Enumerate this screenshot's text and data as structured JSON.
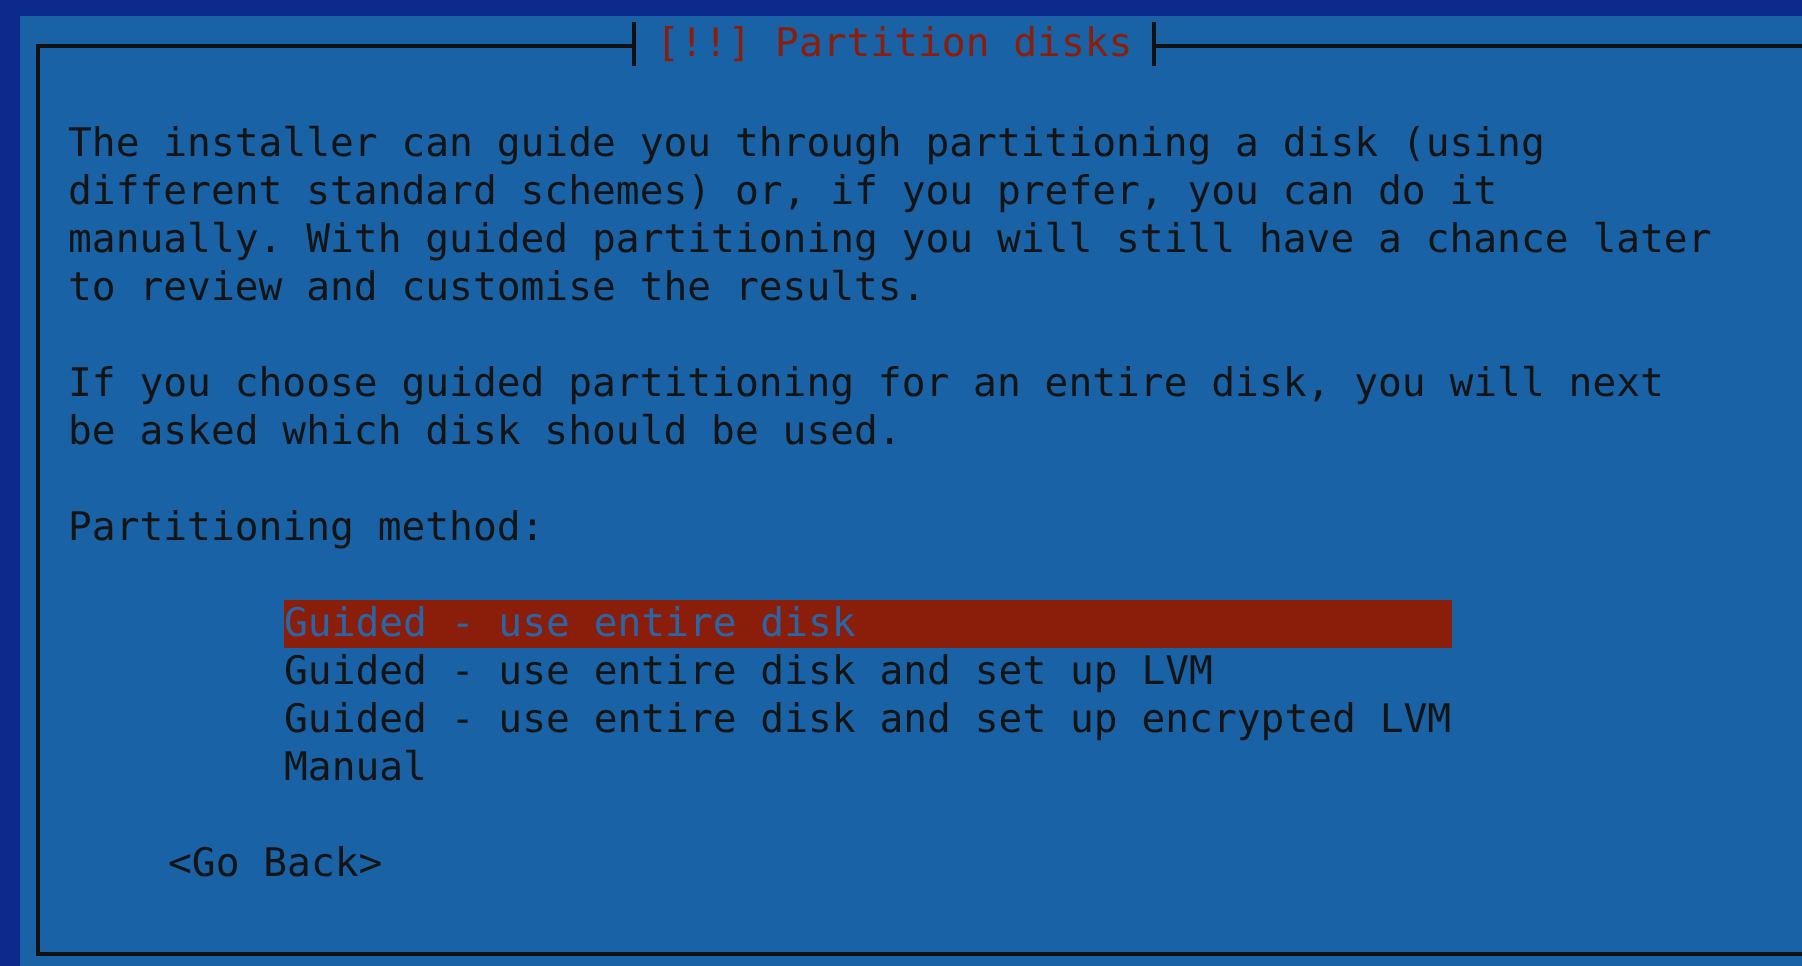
{
  "dialog": {
    "title": "[!!] Partition disks",
    "paragraphs": [
      "The installer can guide you through partitioning a disk (using different standard schemes) or, if you prefer, you can do it manually. With guided partitioning you will still have a chance later to review and customise the results.",
      "If you choose guided partitioning for an entire disk, you will next be asked which disk should be used."
    ],
    "prompt": "Partitioning method:",
    "options": [
      {
        "label": "Guided - use entire disk",
        "selected": true
      },
      {
        "label": "Guided - use entire disk and set up LVM",
        "selected": false
      },
      {
        "label": "Guided - use entire disk and set up encrypted LVM",
        "selected": false
      },
      {
        "label": "Manual",
        "selected": false
      }
    ],
    "back_button": "<Go Back>"
  }
}
